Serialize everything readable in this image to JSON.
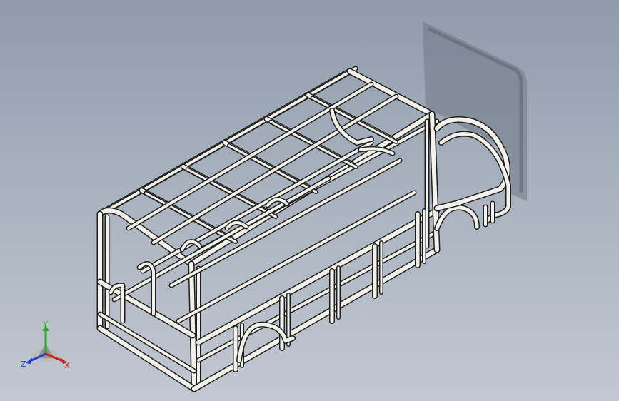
{
  "viewport": {
    "background_top": "#8f9bab",
    "background_bottom": "#c2c8d1",
    "model": "bus-frame-wireframe",
    "tube_color": "#f3f2ea",
    "outline_color": "#1e1e1e"
  },
  "triad": {
    "x_label": "X",
    "y_label": "Y",
    "z_label": "Z",
    "x_color": "#d21d1d",
    "y_color": "#2fa52f",
    "z_color": "#1f3fd2"
  }
}
